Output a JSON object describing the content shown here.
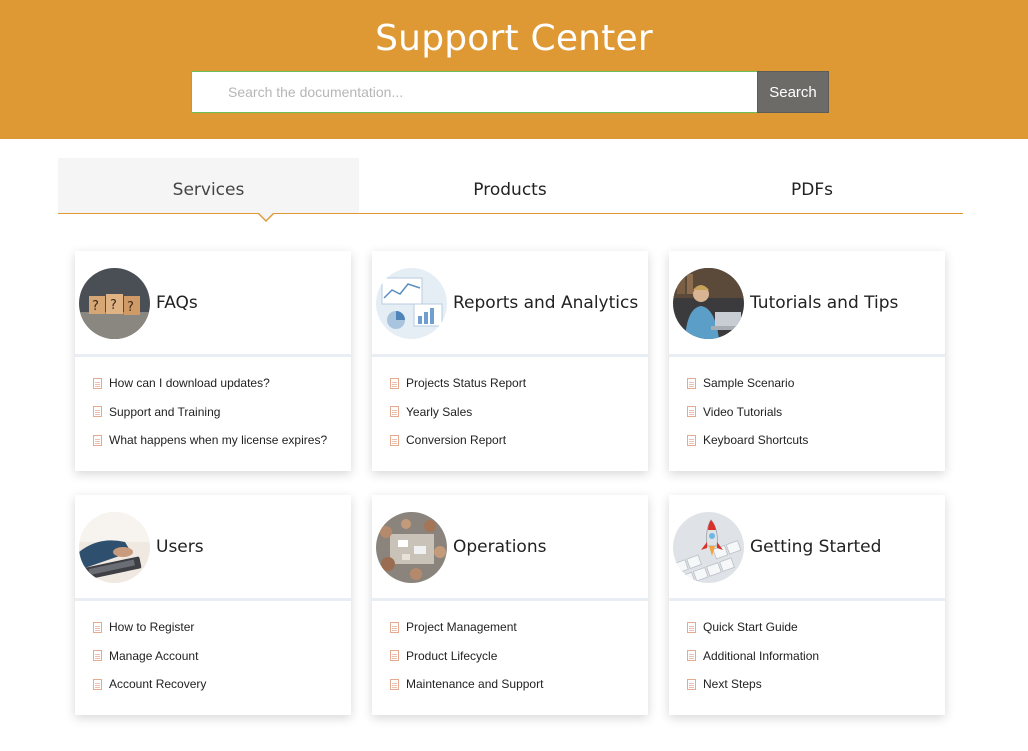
{
  "header": {
    "title": "Support Center",
    "search_placeholder": "Search the documentation...",
    "search_button": "Search",
    "background_color": "#de9935"
  },
  "tabs": [
    {
      "label": "Services",
      "active": true
    },
    {
      "label": "Products",
      "active": false
    },
    {
      "label": "PDFs",
      "active": false
    }
  ],
  "cards": [
    {
      "title": "FAQs",
      "image": "question-blocks-photo",
      "items": [
        "How can I download updates?",
        "Support and Training",
        "What happens when my license expires?"
      ]
    },
    {
      "title": "Reports and Analytics",
      "image": "analytics-charts-photo",
      "items": [
        "Projects Status Report",
        "Yearly Sales",
        "Conversion Report"
      ]
    },
    {
      "title": "Tutorials and Tips",
      "image": "person-laptop-photo",
      "items": [
        "Sample Scenario",
        "Video Tutorials",
        "Keyboard Shortcuts"
      ]
    },
    {
      "title": "Users",
      "image": "typing-keyboard-photo",
      "items": [
        "How to Register",
        "Manage Account",
        "Account Recovery"
      ]
    },
    {
      "title": "Operations",
      "image": "team-meeting-photo",
      "items": [
        "Project Management",
        "Product Lifecycle",
        "Maintenance and Support"
      ]
    },
    {
      "title": "Getting Started",
      "image": "rocket-keyboard-photo",
      "items": [
        "Quick Start Guide",
        "Additional Information",
        "Next Steps"
      ]
    }
  ],
  "list_item_icon": "document-icon"
}
